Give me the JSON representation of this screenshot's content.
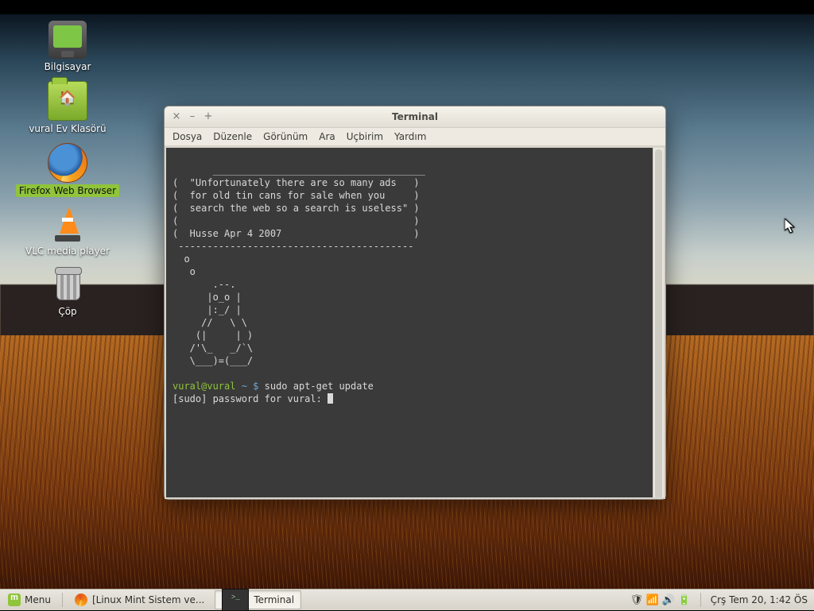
{
  "desktop": {
    "icons": [
      {
        "name": "computer",
        "label": "Bilgisayar"
      },
      {
        "name": "home",
        "label": "vural Ev Klasörü"
      },
      {
        "name": "firefox",
        "label": "Firefox Web Browser",
        "selected": true
      },
      {
        "name": "vlc",
        "label": "VLC media player"
      },
      {
        "name": "trash",
        "label": "Çöp"
      }
    ]
  },
  "window": {
    "title": "Terminal",
    "menu": [
      "Dosya",
      "Düzenle",
      "Görünüm",
      "Ara",
      "Uçbirim",
      "Yardım"
    ],
    "motd": [
      " _____________________________________",
      "(  \"Unfortunately there are so many ads   )",
      "(  for old tin cans for sale when you     )",
      "(  search the web so a search is useless\" )",
      "(                                         )",
      "(  Husse Apr 4 2007                       )",
      " -----------------------------------------",
      "  o",
      "   o",
      "       .--.",
      "      |o_o |",
      "      |:_/ |",
      "     //   \\ \\",
      "    (|     | )",
      "   /'\\_   _/`\\",
      "   \\___)=(___/",
      ""
    ],
    "prompt": {
      "user": "vural@vural",
      "path": "~",
      "symbol": "$",
      "command": "sudo apt-get update"
    },
    "sudo_prompt": "[sudo] password for vural: "
  },
  "panel": {
    "menu_label": "Menu",
    "tasks": [
      {
        "icon": "ff",
        "label": "[Linux Mint Sistem ve...",
        "active": false
      },
      {
        "icon": "term",
        "label": "Terminal",
        "active": true
      }
    ],
    "tray": {
      "icons": [
        "shield-icon",
        "network-icon",
        "volume-icon",
        "battery-icon"
      ],
      "clock": "Çrş Tem 20,  1:42 ÖS"
    }
  }
}
